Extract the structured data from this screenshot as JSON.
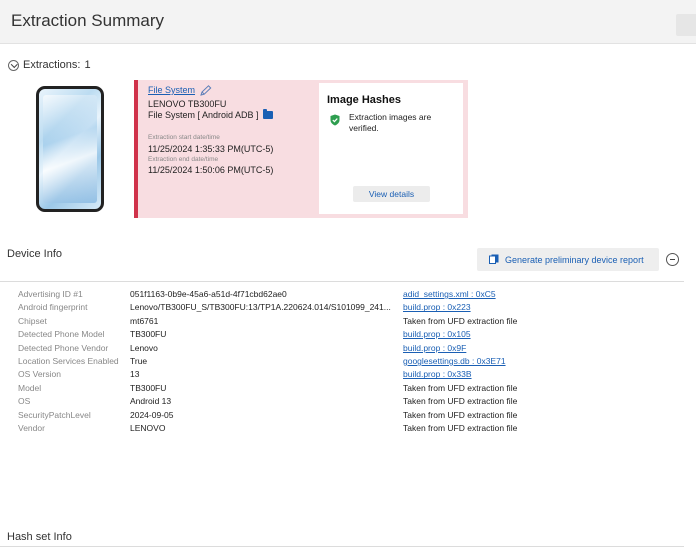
{
  "header": {
    "title": "Extraction Summary"
  },
  "extractions": {
    "label": "Extractions:",
    "count": "1"
  },
  "extraction_card": {
    "file_system_link": "File System",
    "device_model": "LENOVO TB300FU",
    "fs_type": "File System [ Android ADB ]",
    "start_label": "Extraction start date/time",
    "start_value": "11/25/2024 1:35:33 PM(UTC-5)",
    "end_label": "Extraction end date/time",
    "end_value": "11/25/2024 1:50:06 PM(UTC-5)"
  },
  "image_hashes": {
    "title": "Image Hashes",
    "status_text": "Extraction images are verified.",
    "view_details_label": "View details",
    "status_color": "#2e9e4f"
  },
  "device_info": {
    "title": "Device Info",
    "generate_button_label": "Generate preliminary device report",
    "rows": [
      {
        "label": "Advertising ID #1",
        "value": "051f1163-0b9e-45a6-a51d-4f71cbd62ae0",
        "source": "adid_settings.xml : 0xC5",
        "is_link": true
      },
      {
        "label": "Android fingerprint",
        "value": "Lenovo/TB300FU_S/TB300FU:13/TP1A.220624.014/S101099_241...",
        "source": "build.prop : 0x223",
        "is_link": true
      },
      {
        "label": "Chipset",
        "value": "mt6761",
        "source": "Taken from UFD extraction file",
        "is_link": false
      },
      {
        "label": "Detected Phone Model",
        "value": "TB300FU",
        "source": "build.prop : 0x105",
        "is_link": true
      },
      {
        "label": "Detected Phone Vendor",
        "value": "Lenovo",
        "source": "build.prop : 0x9F",
        "is_link": true
      },
      {
        "label": "Location Services Enabled",
        "value": "True",
        "source": "googlesettings.db : 0x3E71",
        "is_link": true
      },
      {
        "label": "OS Version",
        "value": "13",
        "source": "build.prop : 0x33B",
        "is_link": true
      },
      {
        "label": "Model",
        "value": "TB300FU",
        "source": "Taken from UFD extraction file",
        "is_link": false
      },
      {
        "label": "OS",
        "value": "Android 13",
        "source": "Taken from UFD extraction file",
        "is_link": false
      },
      {
        "label": "SecurityPatchLevel",
        "value": "2024-09-05",
        "source": "Taken from UFD extraction file",
        "is_link": false
      },
      {
        "label": "Vendor",
        "value": "LENOVO",
        "source": "Taken from UFD extraction file",
        "is_link": false
      }
    ]
  },
  "hash_set_info": {
    "title": "Hash set Info"
  },
  "colors": {
    "accent": "#1a5fb4",
    "card_bg": "#f8dde1",
    "card_border": "#d0324a"
  }
}
